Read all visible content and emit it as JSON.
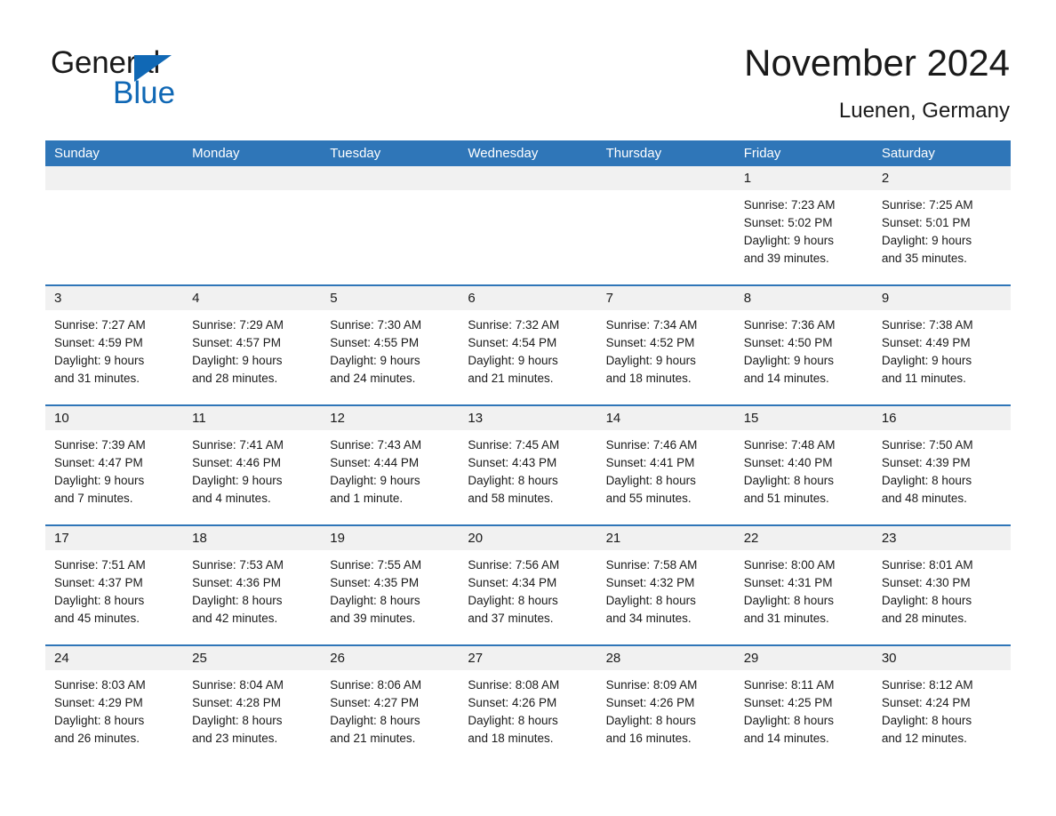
{
  "brand": {
    "name_part1": "General",
    "name_part2": "Blue",
    "triangle_icon": "blue-triangle-icon",
    "accent_color": "#1068b5"
  },
  "header": {
    "month_title": "November 2024",
    "location": "Luenen, Germany"
  },
  "theme": {
    "header_blue": "#2f76b8",
    "day_band_gray": "#f1f1f1",
    "text_color": "#1a1a1a"
  },
  "calendar": {
    "weekdays": [
      "Sunday",
      "Monday",
      "Tuesday",
      "Wednesday",
      "Thursday",
      "Friday",
      "Saturday"
    ],
    "weeks": [
      [
        {
          "day": "",
          "lines": []
        },
        {
          "day": "",
          "lines": []
        },
        {
          "day": "",
          "lines": []
        },
        {
          "day": "",
          "lines": []
        },
        {
          "day": "",
          "lines": []
        },
        {
          "day": "1",
          "lines": [
            "Sunrise: 7:23 AM",
            "Sunset: 5:02 PM",
            "Daylight: 9 hours",
            "and 39 minutes."
          ]
        },
        {
          "day": "2",
          "lines": [
            "Sunrise: 7:25 AM",
            "Sunset: 5:01 PM",
            "Daylight: 9 hours",
            "and 35 minutes."
          ]
        }
      ],
      [
        {
          "day": "3",
          "lines": [
            "Sunrise: 7:27 AM",
            "Sunset: 4:59 PM",
            "Daylight: 9 hours",
            "and 31 minutes."
          ]
        },
        {
          "day": "4",
          "lines": [
            "Sunrise: 7:29 AM",
            "Sunset: 4:57 PM",
            "Daylight: 9 hours",
            "and 28 minutes."
          ]
        },
        {
          "day": "5",
          "lines": [
            "Sunrise: 7:30 AM",
            "Sunset: 4:55 PM",
            "Daylight: 9 hours",
            "and 24 minutes."
          ]
        },
        {
          "day": "6",
          "lines": [
            "Sunrise: 7:32 AM",
            "Sunset: 4:54 PM",
            "Daylight: 9 hours",
            "and 21 minutes."
          ]
        },
        {
          "day": "7",
          "lines": [
            "Sunrise: 7:34 AM",
            "Sunset: 4:52 PM",
            "Daylight: 9 hours",
            "and 18 minutes."
          ]
        },
        {
          "day": "8",
          "lines": [
            "Sunrise: 7:36 AM",
            "Sunset: 4:50 PM",
            "Daylight: 9 hours",
            "and 14 minutes."
          ]
        },
        {
          "day": "9",
          "lines": [
            "Sunrise: 7:38 AM",
            "Sunset: 4:49 PM",
            "Daylight: 9 hours",
            "and 11 minutes."
          ]
        }
      ],
      [
        {
          "day": "10",
          "lines": [
            "Sunrise: 7:39 AM",
            "Sunset: 4:47 PM",
            "Daylight: 9 hours",
            "and 7 minutes."
          ]
        },
        {
          "day": "11",
          "lines": [
            "Sunrise: 7:41 AM",
            "Sunset: 4:46 PM",
            "Daylight: 9 hours",
            "and 4 minutes."
          ]
        },
        {
          "day": "12",
          "lines": [
            "Sunrise: 7:43 AM",
            "Sunset: 4:44 PM",
            "Daylight: 9 hours",
            "and 1 minute."
          ]
        },
        {
          "day": "13",
          "lines": [
            "Sunrise: 7:45 AM",
            "Sunset: 4:43 PM",
            "Daylight: 8 hours",
            "and 58 minutes."
          ]
        },
        {
          "day": "14",
          "lines": [
            "Sunrise: 7:46 AM",
            "Sunset: 4:41 PM",
            "Daylight: 8 hours",
            "and 55 minutes."
          ]
        },
        {
          "day": "15",
          "lines": [
            "Sunrise: 7:48 AM",
            "Sunset: 4:40 PM",
            "Daylight: 8 hours",
            "and 51 minutes."
          ]
        },
        {
          "day": "16",
          "lines": [
            "Sunrise: 7:50 AM",
            "Sunset: 4:39 PM",
            "Daylight: 8 hours",
            "and 48 minutes."
          ]
        }
      ],
      [
        {
          "day": "17",
          "lines": [
            "Sunrise: 7:51 AM",
            "Sunset: 4:37 PM",
            "Daylight: 8 hours",
            "and 45 minutes."
          ]
        },
        {
          "day": "18",
          "lines": [
            "Sunrise: 7:53 AM",
            "Sunset: 4:36 PM",
            "Daylight: 8 hours",
            "and 42 minutes."
          ]
        },
        {
          "day": "19",
          "lines": [
            "Sunrise: 7:55 AM",
            "Sunset: 4:35 PM",
            "Daylight: 8 hours",
            "and 39 minutes."
          ]
        },
        {
          "day": "20",
          "lines": [
            "Sunrise: 7:56 AM",
            "Sunset: 4:34 PM",
            "Daylight: 8 hours",
            "and 37 minutes."
          ]
        },
        {
          "day": "21",
          "lines": [
            "Sunrise: 7:58 AM",
            "Sunset: 4:32 PM",
            "Daylight: 8 hours",
            "and 34 minutes."
          ]
        },
        {
          "day": "22",
          "lines": [
            "Sunrise: 8:00 AM",
            "Sunset: 4:31 PM",
            "Daylight: 8 hours",
            "and 31 minutes."
          ]
        },
        {
          "day": "23",
          "lines": [
            "Sunrise: 8:01 AM",
            "Sunset: 4:30 PM",
            "Daylight: 8 hours",
            "and 28 minutes."
          ]
        }
      ],
      [
        {
          "day": "24",
          "lines": [
            "Sunrise: 8:03 AM",
            "Sunset: 4:29 PM",
            "Daylight: 8 hours",
            "and 26 minutes."
          ]
        },
        {
          "day": "25",
          "lines": [
            "Sunrise: 8:04 AM",
            "Sunset: 4:28 PM",
            "Daylight: 8 hours",
            "and 23 minutes."
          ]
        },
        {
          "day": "26",
          "lines": [
            "Sunrise: 8:06 AM",
            "Sunset: 4:27 PM",
            "Daylight: 8 hours",
            "and 21 minutes."
          ]
        },
        {
          "day": "27",
          "lines": [
            "Sunrise: 8:08 AM",
            "Sunset: 4:26 PM",
            "Daylight: 8 hours",
            "and 18 minutes."
          ]
        },
        {
          "day": "28",
          "lines": [
            "Sunrise: 8:09 AM",
            "Sunset: 4:26 PM",
            "Daylight: 8 hours",
            "and 16 minutes."
          ]
        },
        {
          "day": "29",
          "lines": [
            "Sunrise: 8:11 AM",
            "Sunset: 4:25 PM",
            "Daylight: 8 hours",
            "and 14 minutes."
          ]
        },
        {
          "day": "30",
          "lines": [
            "Sunrise: 8:12 AM",
            "Sunset: 4:24 PM",
            "Daylight: 8 hours",
            "and 12 minutes."
          ]
        }
      ]
    ]
  }
}
